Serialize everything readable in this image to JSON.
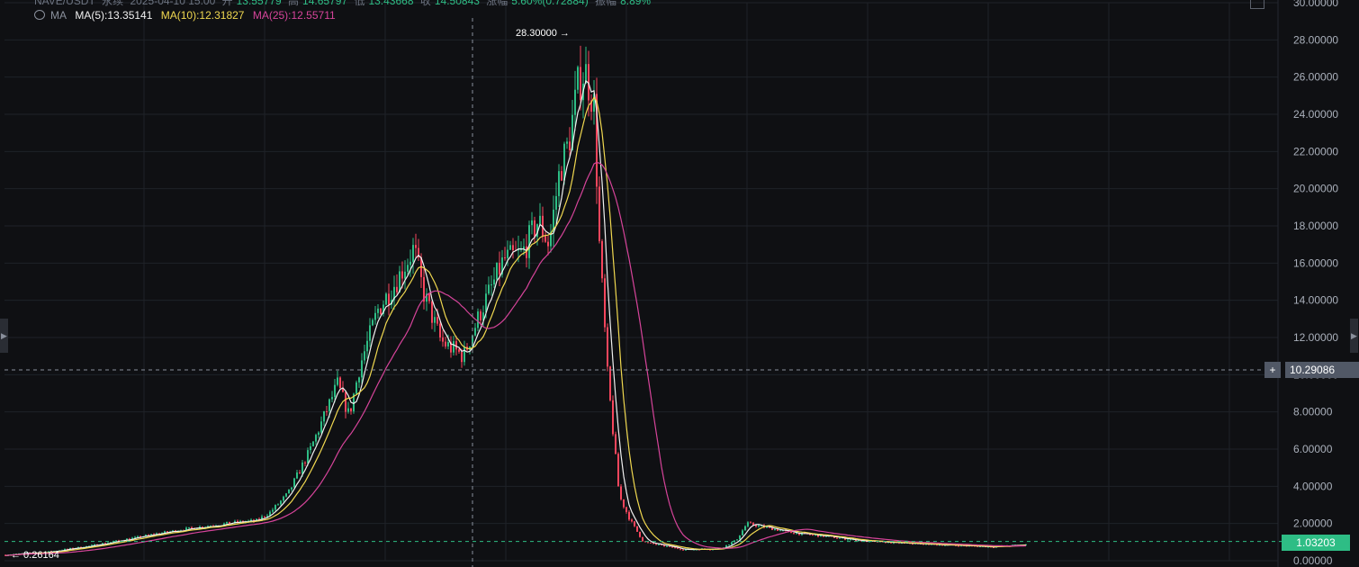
{
  "header": {
    "pair": "NAVE/USDT",
    "interval": "永续",
    "date": "2025-04-10 15:00",
    "open_label": "开",
    "open": "13.55779",
    "high_label": "高",
    "high": "14.65797",
    "low_label": "低",
    "low": "13.43668",
    "close_label": "收",
    "close": "14.50843",
    "change_label": "涨幅",
    "change": "5.60%(0.72884)",
    "amp_label": "振幅",
    "amp": "8.89%"
  },
  "ma": {
    "title": "MA",
    "ma5": "MA(5):13.35141",
    "ma10": "MA(10):12.31827",
    "ma25": "MA(25):12.55711",
    "colors": {
      "ma5": "#f0f0f0",
      "ma10": "#f0d850",
      "ma25": "#d6449a"
    }
  },
  "crosshair_price": "10.29086",
  "last_price": "1.03203",
  "high_marker": "28.30000 →",
  "low_marker": "← 0.26164",
  "colors": {
    "up": "#2ebd85",
    "down": "#f6465d",
    "background": "#0f1013",
    "grid": "#1f2228"
  },
  "icons": {
    "eye": "eye-icon",
    "fullscreen": "fullscreen-icon",
    "left_handle": "chevron-left-icon",
    "right_handle": "chevron-right-icon",
    "crosshair_add": "plus-icon"
  },
  "chart_data": {
    "type": "candlestick",
    "ylim": [
      0,
      30
    ],
    "yticks": [
      "0.00000",
      "2.00000",
      "4.00000",
      "6.00000",
      "8.00000",
      "10.00000",
      "12.00000",
      "14.00000",
      "16.00000",
      "18.00000",
      "20.00000",
      "22.00000",
      "24.00000",
      "26.00000",
      "28.00000",
      "30.00000"
    ],
    "yvalues": [
      0,
      2,
      4,
      6,
      8,
      10,
      12,
      14,
      16,
      18,
      20,
      22,
      24,
      26,
      28,
      30
    ],
    "grid": true,
    "price_anchors": [
      [
        0,
        0.3
      ],
      [
        50,
        0.45
      ],
      [
        100,
        0.8
      ],
      [
        140,
        1.15
      ],
      [
        180,
        1.5
      ],
      [
        220,
        1.8
      ],
      [
        260,
        2.05
      ],
      [
        285,
        2.15
      ],
      [
        300,
        2.6
      ],
      [
        320,
        3.6
      ],
      [
        345,
        6.0
      ],
      [
        375,
        9.5
      ],
      [
        388,
        7.8
      ],
      [
        400,
        10.5
      ],
      [
        420,
        13.5
      ],
      [
        440,
        15.0
      ],
      [
        460,
        16.8
      ],
      [
        470,
        14.5
      ],
      [
        490,
        11.8
      ],
      [
        515,
        11.0
      ],
      [
        535,
        13.5
      ],
      [
        560,
        16.2
      ],
      [
        580,
        16.5
      ],
      [
        598,
        18.3
      ],
      [
        610,
        17.0
      ],
      [
        622,
        21.0
      ],
      [
        632,
        22.5
      ],
      [
        642,
        25.5
      ],
      [
        650,
        26.4
      ],
      [
        660,
        24.5
      ],
      [
        666,
        17.0
      ],
      [
        675,
        10.0
      ],
      [
        688,
        3.5
      ],
      [
        700,
        2.2
      ],
      [
        715,
        1.0
      ],
      [
        760,
        0.6
      ],
      [
        800,
        0.65
      ],
      [
        818,
        1.1
      ],
      [
        830,
        2.0
      ],
      [
        850,
        1.8
      ],
      [
        880,
        1.5
      ],
      [
        920,
        1.3
      ],
      [
        960,
        1.05
      ],
      [
        1000,
        0.95
      ],
      [
        1050,
        0.85
      ],
      [
        1100,
        0.75
      ],
      [
        1140,
        0.85
      ]
    ],
    "candle_x_start": 0,
    "candle_x_end": 1140,
    "candle_step": 3
  }
}
